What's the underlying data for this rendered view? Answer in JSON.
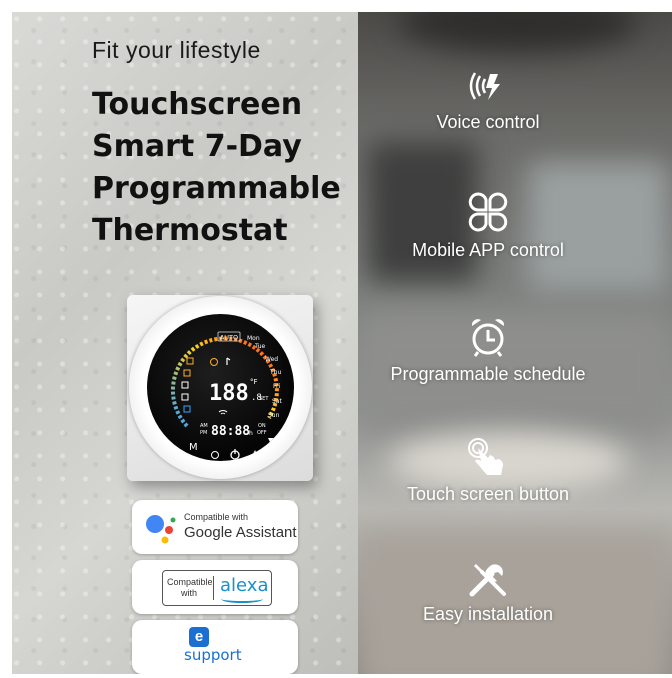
{
  "left": {
    "tagline": "Fit your lifestyle",
    "title_lines": [
      "Touchscreen",
      "Smart 7-Day",
      "Programmable",
      "Thermostat"
    ]
  },
  "thermostat": {
    "mode_label": "AUTO",
    "days": [
      "Mon",
      "Tue",
      "Wed",
      "Thu",
      "Fri",
      "Sat",
      "Sun"
    ],
    "temp_digits": "188",
    "temp_decimal": ".8",
    "temp_unit": "°F",
    "set_label": "SET",
    "time_am": "AM",
    "time_pm": "PM",
    "time_digits": "88:88",
    "time_suffix": "h",
    "on_label": "ON",
    "off_label": "OFF",
    "m_button": "M",
    "power_icon": "power-icon",
    "up_icon": "arrow-up-icon",
    "down_icon": "arrow-down-icon",
    "accent_gradient": [
      "#33a3ff",
      "#ffd21a",
      "#ff3a1a"
    ]
  },
  "badges": {
    "google": {
      "small": "Compatible with",
      "big": "Google Assistant"
    },
    "alexa": {
      "compatible": "Compatible",
      "with": "with",
      "word": "alexa"
    },
    "esupport": {
      "e": "e",
      "word": "support"
    }
  },
  "features": [
    {
      "icon": "voice-control-icon",
      "label": "Voice control"
    },
    {
      "icon": "mobile-app-icon",
      "label": "Mobile APP control"
    },
    {
      "icon": "alarm-clock-icon",
      "label": "Programmable schedule"
    },
    {
      "icon": "touch-hand-icon",
      "label": "Touch screen button"
    },
    {
      "icon": "tools-icon",
      "label": "Easy installation"
    }
  ],
  "colors": {
    "alexa_blue": "#1a8fc9",
    "esupport_blue": "#1a6fd1",
    "google_blue": "#4285F4",
    "google_red": "#EA4335",
    "google_yellow": "#FBBC05",
    "google_green": "#34A853"
  }
}
